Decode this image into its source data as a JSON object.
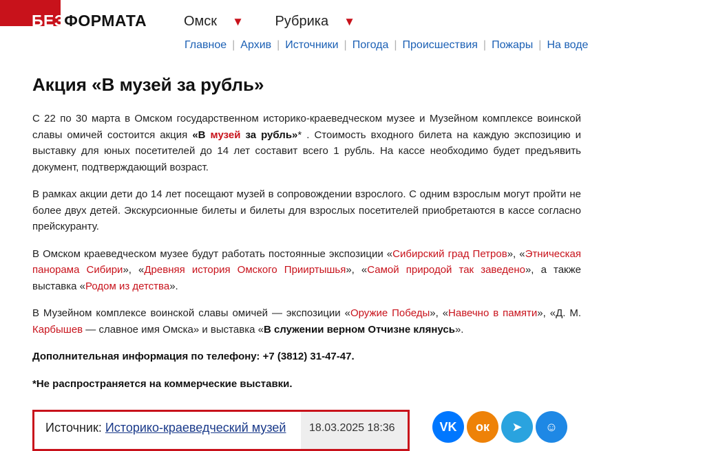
{
  "logo": {
    "white_part": "БЕЗ",
    "dark_part": "ФОРМАТА"
  },
  "top_nav": {
    "city": "Омск",
    "rubric": "Рубрика",
    "arrow": "▼"
  },
  "sub_nav": {
    "items": [
      "Главное",
      "Архив",
      "Источники",
      "Погода",
      "Происшествия",
      "Пожары",
      "На воде"
    ],
    "separator": "|"
  },
  "article": {
    "title": "Акция «В музей за рубль»",
    "p1": {
      "a": "С 22 по 30 марта в Омском государственном историко-краеведческом музее и Музейном комплексе воинской славы омичей состоится акция ",
      "b1": "«В ",
      "b_red": "музей",
      "b2": " за рубль»",
      "star": "*",
      "c": " . Стоимость входного билета на каждую экспозицию и выставку для юных посетителей до 14 лет составит всего 1 рубль. На кассе необходимо будет предъявить документ, подтверждающий возраст."
    },
    "p2": "В рамках акции дети до 14 лет посещают музей в сопровождении взрослого. С одним взрослым могут пройти не более двух детей.  Экскурсионные билеты и билеты для взрослых посетителей приобретаются в кассе согласно прейскуранту.",
    "p3": {
      "a": "В Омском краеведческом музее будут работать постоянные экспозиции «",
      "r1": "Сибирский град Петров",
      "b": "», «",
      "r2": "Этническая панорама Сибири",
      "c": "», «",
      "r3": "Древняя история Омского Прииртышья",
      "d": "», «",
      "r4": "Самой природой так заведено",
      "e": "», а также выставка «",
      "r5": "Родом из детства",
      "f": "»."
    },
    "p4": {
      "a": "В Музейном комплексе воинской славы омичей — экспозиции «",
      "r1": "Оружие Победы",
      "b": "», «",
      "r2": "Навечно в памяти",
      "c": "», «Д. М. ",
      "r3": "Карбышев",
      "d": " — славное имя Омска» и выставка «",
      "bold": "В служении верном Отчизне клянусь",
      "e": "»."
    },
    "phone_note": "Дополнительная информация по телефону: +7 (3812) 31-47-47.",
    "footnote": "*Не распространяется на коммерческие выставки."
  },
  "source": {
    "label": "Источник: ",
    "link": "Историко-краеведческий музей",
    "date": "18.03.2025 18:36"
  },
  "social": {
    "vk": {
      "glyph": "VK",
      "color": "#0077ff"
    },
    "ok": {
      "glyph": "ок",
      "color": "#ee8208"
    },
    "telegram": {
      "glyph": "➤",
      "color": "#2aa3df"
    },
    "fourth": {
      "glyph": "☺",
      "color": "#1e88e5"
    }
  }
}
